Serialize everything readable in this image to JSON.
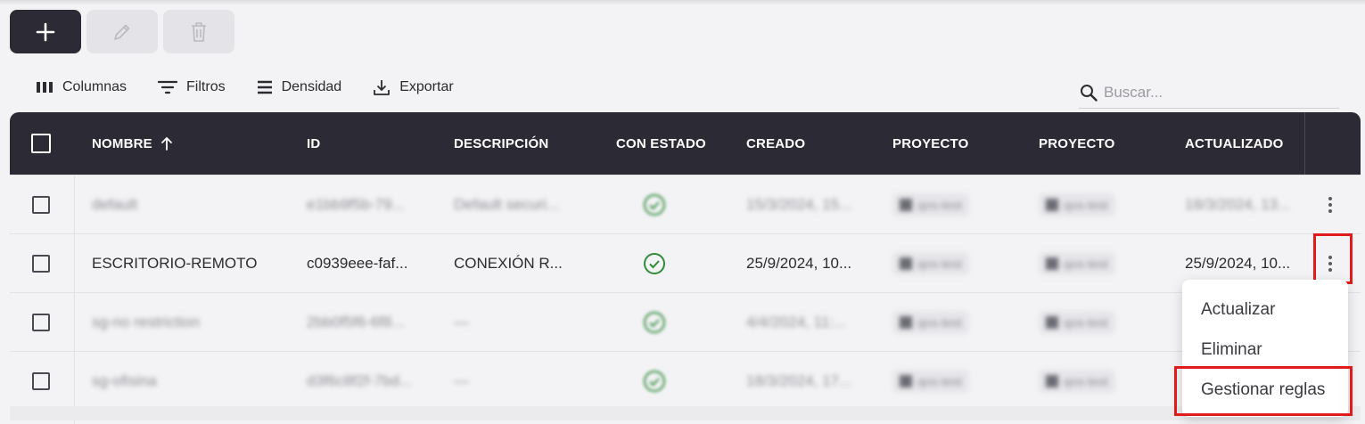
{
  "actions": {
    "add_icon": "plus-icon",
    "edit_icon": "pencil-icon",
    "delete_icon": "trash-icon"
  },
  "toolbar": {
    "columns": "Columnas",
    "filters": "Filtros",
    "density": "Densidad",
    "export": "Exportar"
  },
  "search": {
    "placeholder": "Buscar..."
  },
  "table": {
    "headers": {
      "name": "NOMBRE",
      "id": "ID",
      "description": "DESCRIPCIÓN",
      "stateful": "CON ESTADO",
      "created": "CREADO",
      "project1": "PROYECTO",
      "project2": "PROYECTO",
      "updated": "ACTUALIZADO"
    },
    "sort_icon": "arrow-up-icon",
    "rows": [
      {
        "name": "default",
        "id": "e1bb9f5b-79...",
        "description": "Default securi...",
        "created": "15/3/2024, 15...",
        "project1": "qos-test",
        "project2": "qos-test",
        "updated": "18/3/2024, 13..."
      },
      {
        "name": "ESCRITORIO-REMOTO",
        "id": "c0939eee-faf...",
        "description": "CONEXIÓN R...",
        "created": "25/9/2024, 10...",
        "project1": "qos-test",
        "project2": "qos-test",
        "updated": "25/9/2024, 10..."
      },
      {
        "name": "sg-no restriction",
        "id": "2bb0f5f6-6f8...",
        "description": "—",
        "created": "4/4/2024, 11:...",
        "project1": "qos-test",
        "project2": "qos-test",
        "updated": ""
      },
      {
        "name": "sg-ofisina",
        "id": "d3f6c8f2f-7bd...",
        "description": "—",
        "created": "18/3/2024, 17...",
        "project1": "qos-test",
        "project2": "qos-test",
        "updated": ""
      }
    ]
  },
  "menu": {
    "update": "Actualizar",
    "delete": "Eliminar",
    "manage_rules": "Gestionar reglas"
  },
  "colors": {
    "header_bg": "#2b2a35",
    "highlight": "#e11b1b",
    "status_green": "#2e8b3a"
  }
}
